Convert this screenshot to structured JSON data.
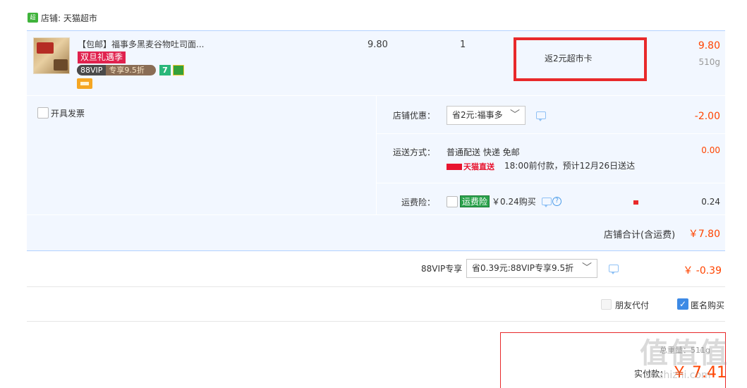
{
  "shop": {
    "logo_text": "超市",
    "name": "店铺: 天猫超市"
  },
  "item": {
    "title": "【包邮】福事多黑麦谷物吐司面...",
    "tag_holiday": "双旦礼遇季",
    "tag_vip_a": "88VIP",
    "tag_vip_b": "专享9.5折",
    "tag_seven": "7",
    "unit_price": "9.80",
    "quantity": "1",
    "rebate": "返2元超市卡",
    "subtotal": "9.80",
    "weight": "510g"
  },
  "options": {
    "invoice_label": "开具发票",
    "discount_label": "店铺优惠：",
    "discount_select": "省2元:福事多",
    "discount_amount": "-2.00",
    "shipping_label": "运送方式：",
    "shipping_method": "普通配送 快递 免邮",
    "tmall_direct": "天猫直送",
    "shipping_eta": "18:00前付款，预计12月26日送达",
    "shipping_amount": "0.00",
    "insurance_label": "运费险：",
    "insurance_badge": "运费险",
    "insurance_price": "￥0.24购买",
    "insurance_amount": "0.24"
  },
  "shop_total": {
    "label": "店铺合计(含运费)",
    "amount": "￥7.80"
  },
  "vip": {
    "label": "88VIP专享",
    "select": "省0.39元:88VIP专享9.5折",
    "amount": "￥ -0.39"
  },
  "pay_options": {
    "friend_pay": "朋友代付",
    "anonymous": "匿名购买",
    "anonymous_checked": true
  },
  "pay": {
    "weight": "总重量：511g",
    "label": "实付款：",
    "amount": "￥ 7.41"
  },
  "watermark": {
    "text": "值值值",
    "url": "zhizhizhi.com"
  },
  "colors": {
    "accent_red": "#ff4400",
    "row_bg": "#f2f7ff",
    "highlight_box": "#e8292a"
  }
}
